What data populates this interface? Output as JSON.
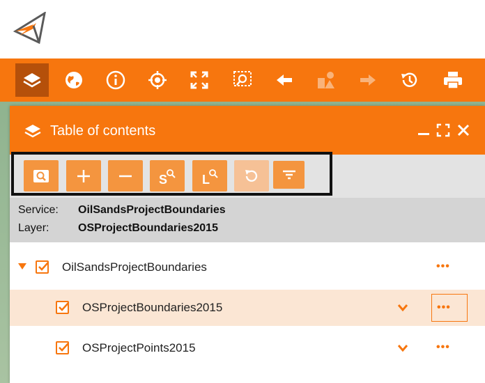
{
  "colors": {
    "accent": "#f7760e",
    "active_tool": "#b5500a",
    "selected_row": "#fbe6d4"
  },
  "header": {
    "logo_icon": "arrow-logo"
  },
  "toolbar": {
    "items": [
      {
        "icon": "layers-icon",
        "active": true
      },
      {
        "icon": "globe-icon"
      },
      {
        "icon": "info-icon"
      },
      {
        "icon": "locate-icon"
      },
      {
        "icon": "full-extent-icon"
      },
      {
        "icon": "zoom-selection-icon"
      },
      {
        "icon": "arrow-left-icon"
      },
      {
        "icon": "shapes-icon",
        "disabled": true
      },
      {
        "icon": "arrow-right-icon",
        "disabled": true
      },
      {
        "icon": "history-icon"
      },
      {
        "icon": "print-icon"
      }
    ]
  },
  "panel": {
    "title": "Table of contents",
    "tools": [
      {
        "icon": "zoom-to-icon"
      },
      {
        "icon": "plus-icon"
      },
      {
        "icon": "minus-icon"
      },
      {
        "icon": "service-search-icon",
        "text": "S"
      },
      {
        "icon": "layer-search-icon",
        "text": "L"
      },
      {
        "icon": "reset-icon",
        "disabled": true
      },
      {
        "icon": "filter-icon"
      }
    ],
    "info": {
      "service_label": "Service:",
      "service_value": "OilSandsProjectBoundaries",
      "layer_label": "Layer:",
      "layer_value": "OSProjectBoundaries2015"
    },
    "tree": {
      "parent": {
        "label": "OilSandsProjectBoundaries",
        "checked": true,
        "expanded": true
      },
      "children": [
        {
          "label": "OSProjectBoundaries2015",
          "checked": true,
          "selected": true
        },
        {
          "label": "OSProjectPoints2015",
          "checked": true,
          "selected": false
        }
      ]
    }
  }
}
